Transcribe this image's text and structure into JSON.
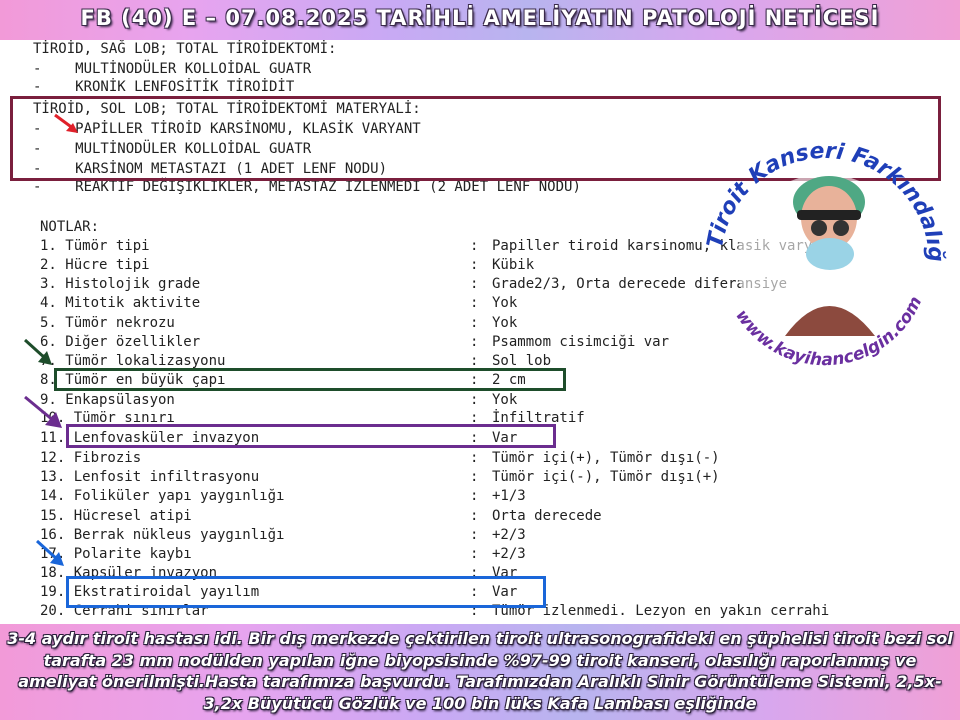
{
  "title": "FB (40) E –  07.08.2025 TARİHLİ AMELİYATIN PATOLOJİ NETİCESİ",
  "pathology_lines": [
    "TİROİD, SAĞ LOB; TOTAL TİROİDEKTOMİ:",
    "-    MULTİNODÜLER KOLLOİDAL GUATR",
    "-    KRONİK LENFOSİTİK TİROİDİT",
    "TİROİD, SOL LOB; TOTAL TİROİDEKTOMİ MATERYALİ:",
    "-    PAPİLLER TİROİD KARSİNOMU, KLASİK VARYANT",
    "-    MULTİNODÜLER KOLLOİDAL GUATR",
    "-    KARSİNOM METASTAZI (1 ADET LENF NODU)",
    "-    REAKTİF DEĞİŞİKLİKLER, METASTAZ İZLENMEDİ (2 ADET LENF NODU)"
  ],
  "notes_heading": "NOTLAR:",
  "notes": [
    {
      "label": "1. Tümör tipi",
      "value": "Papiller tiroid karsinomu, klasik varyant"
    },
    {
      "label": "2. Hücre tipi",
      "value": "Kübik"
    },
    {
      "label": "3. Histolojik grade",
      "value": "Grade2/3, Orta derecede diferansiye"
    },
    {
      "label": "4. Mitotik aktivite",
      "value": "Yok"
    },
    {
      "label": "5. Tümör nekrozu",
      "value": "Yok"
    },
    {
      "label": "6. Diğer özellikler",
      "value": "Psammom cisimciği var"
    },
    {
      "label": "7. Tümör lokalizasyonu",
      "value": "Sol lob"
    },
    {
      "label": "8. Tümör en büyük çapı",
      "value": "2 cm"
    },
    {
      "label": "9. Enkapsülasyon",
      "value": "Yok"
    },
    {
      "label": "10. Tümör sınırı",
      "value": "İnfiltratif"
    },
    {
      "label": "11. Lenfovasküler invazyon",
      "value": "Var"
    },
    {
      "label": "12. Fibrozis",
      "value": "Tümör içi(+), Tümör dışı(-)"
    },
    {
      "label": "13. Lenfosit infiltrasyonu",
      "value": "Tümör içi(-), Tümör dışı(+)"
    },
    {
      "label": "14. Foliküler yapı yaygınlığı",
      "value": "+1/3"
    },
    {
      "label": "15. Hücresel atipi",
      "value": "Orta derecede"
    },
    {
      "label": "16. Berrak nükleus yaygınlığı",
      "value": "+2/3"
    },
    {
      "label": "17. Polarite kaybı",
      "value": "+2/3"
    },
    {
      "label": "18. Kapsüler invazyon",
      "value": "Var"
    },
    {
      "label": "19. Ekstratiroidal yayılım",
      "value": "Var"
    },
    {
      "label": "20. Cerrahi sınırlar",
      "value": "Tümör izlenmedi. Lezyon en yakın cerrahi"
    }
  ],
  "note_separator": ":",
  "logo": {
    "text_top": "Tiroit Kanseri Farkındalığı",
    "text_bottom": "www.kayihancelgin.com"
  },
  "bottom_text": "3-4 aydır tiroit hastası idi. Bir dış merkezde çektirilen tiroit ultrasonografideki en şüphelisi tiroit bezi sol tarafta 23 mm nodülden yapılan iğne biyopsisinde %97-99 tiroit kanseri, olasılığı raporlanmış ve ameliyat önerilmişti.Hasta tarafımıza başvurdu. Tarafımızdan Aralıklı Sinir Görüntüleme Sistemi, 2,5x-3,2x Büyütücü Gözlük ve 100 bin lüks Kafa Lambası eşliğinde",
  "colors": {
    "maroon_box": "#7a1f3d",
    "green_box": "#1e4d2b",
    "purple_box": "#6b2d8f",
    "blue_box": "#1a66d9",
    "red_arrow": "#e0202a",
    "logo_blue": "#1f3fb8",
    "logo_magenta": "#c0187a",
    "logo_green": "#2ea84a",
    "logo_purple": "#6a2fa0"
  }
}
